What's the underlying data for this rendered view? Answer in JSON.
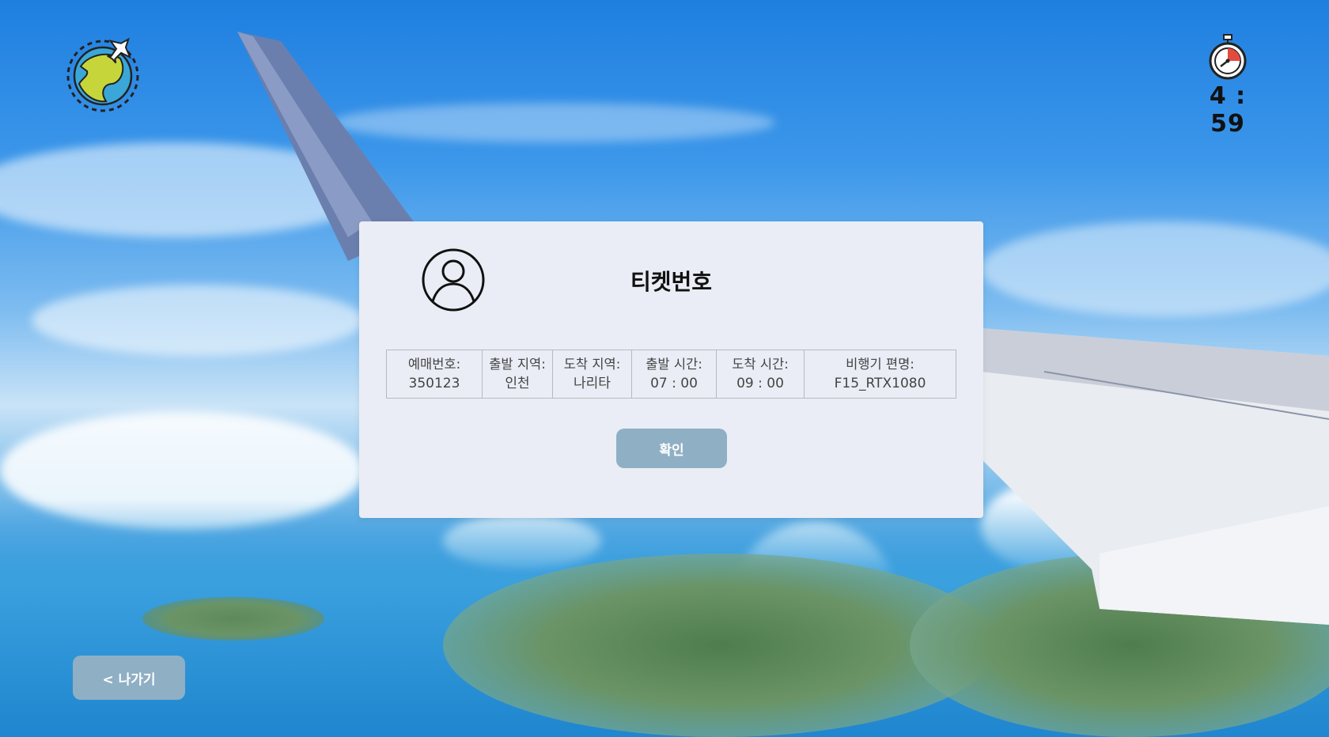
{
  "app": {
    "logo_icon": "globe-airplane-icon",
    "timer_icon": "stopwatch-icon",
    "timer_value": "4 : 59",
    "background": "airplane-wing-sky-photo"
  },
  "card": {
    "avatar_icon": "user-avatar-icon",
    "title": "티켓번호",
    "columns": [
      {
        "label": "예매번호:",
        "value": "350123"
      },
      {
        "label": "출발 지역:",
        "value": "인천"
      },
      {
        "label": "도착 지역:",
        "value": "나리타"
      },
      {
        "label": "출발 시간:",
        "value": "07 : 00"
      },
      {
        "label": "도착 시간:",
        "value": "09 : 00"
      },
      {
        "label": "비행기 편명:",
        "value": "F15_RTX1080"
      }
    ],
    "confirm_label": "확인"
  },
  "footer": {
    "back_label": "< 나가기"
  },
  "colors": {
    "card_bg": "#eaedf5",
    "button_bg": "#8fafc4",
    "button_text": "#ffffff"
  }
}
